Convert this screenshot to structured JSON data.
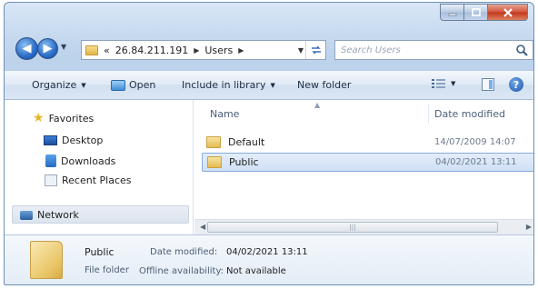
{
  "window": {
    "minimize_icon": "minimize-icon",
    "maximize_icon": "maximize-icon",
    "close_icon": "close-icon"
  },
  "address": {
    "overflow": "«",
    "segments": [
      "26.84.211.191",
      "Users"
    ],
    "refresh_icon": "refresh-icon"
  },
  "search": {
    "placeholder": "Search Users"
  },
  "toolbar": {
    "organize": "Organize",
    "open": "Open",
    "include_in_library": "Include in library",
    "new_folder": "New folder",
    "help": "?"
  },
  "nav": {
    "favorites": "Favorites",
    "desktop": "Desktop",
    "downloads": "Downloads",
    "recent_places": "Recent Places",
    "network": "Network"
  },
  "columns": {
    "name": "Name",
    "date_modified": "Date modified"
  },
  "files": [
    {
      "name": "Default",
      "date": "14/07/2009 14:07",
      "selected": false
    },
    {
      "name": "Public",
      "date": "04/02/2021 13:11",
      "selected": true
    }
  ],
  "details": {
    "name": "Public",
    "type": "File folder",
    "date_label": "Date modified:",
    "date_value": "04/02/2021 13:11",
    "offline_label": "Offline availability:",
    "offline_value": "Not available"
  },
  "colors": {
    "accent": "#3c6db0",
    "selection": "#cfe0f6"
  }
}
